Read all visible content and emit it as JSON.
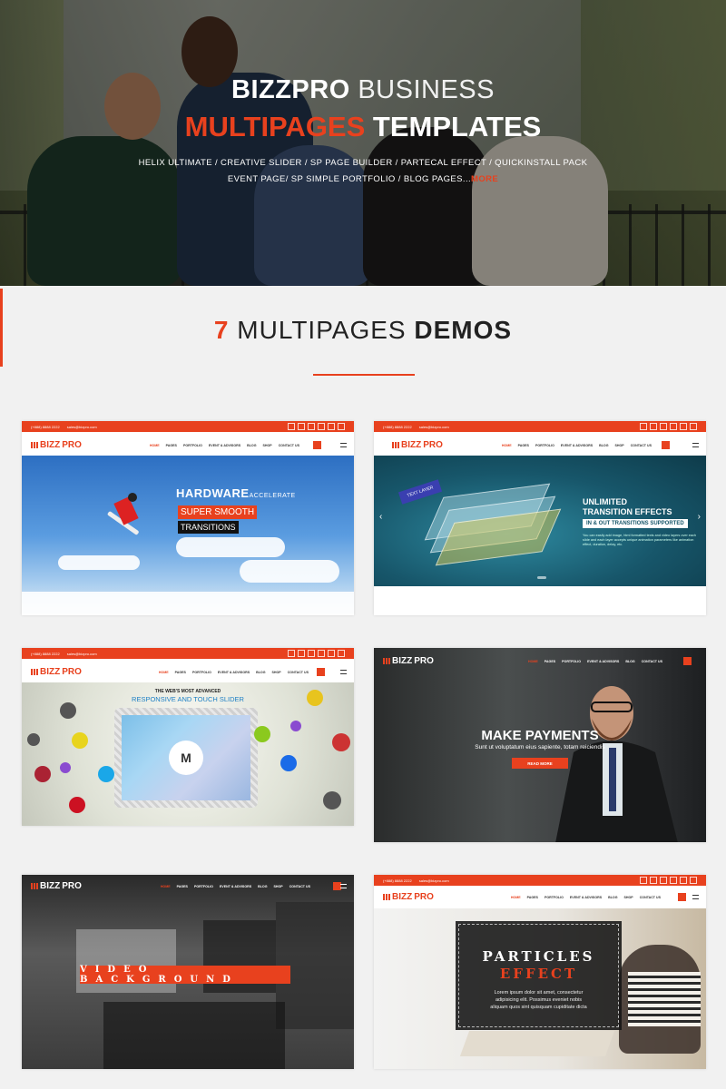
{
  "hero": {
    "title_brand": "BIZZPRO",
    "title_rest": " BUSINESS",
    "title2_accent": "MULTIPAGES",
    "title2_rest": " TEMPLATES",
    "sub1": "HELIX ULTIMATE / CREATIVE SLIDER / SP PAGE BUILDER / PARTECAL EFFECT / QUICKINSTALL PACK",
    "sub2": "EVENT PAGE/ SP SIMPLE PORTFOLIO / BLOG PAGES...",
    "more": "MORE"
  },
  "section": {
    "num": "7",
    "mid": " MULTIPAGES ",
    "bold": "DEMOS"
  },
  "demo": {
    "phone": "(+888) 8888 2222",
    "email": "sales@bizpro.com",
    "logo_a": "BIZZ",
    "logo_b": "PRO",
    "menu": [
      "HOME",
      "PAGES",
      "PORTFOLIO",
      "EVENT & ADVISORS",
      "BLOG",
      "SHOP",
      "CONTACT US"
    ]
  },
  "card1": {
    "title": "HARDWARE",
    "thin": "ACCELERATE",
    "red": "SUPER SMOOTH",
    "black": "TRANSITIONS"
  },
  "card2": {
    "textlayer": "TEXT LAYER",
    "l1": "UNLIMITED",
    "l2": "TRANSITION EFFECTS",
    "bar": "IN & OUT TRANSITIONS SUPPORTED",
    "para": "You can easily add image, html formatted texts and video layers over each slide and each layer accepts unique animation parameters like animation effect, duration, delay, etc."
  },
  "card3": {
    "k1": "THE WEB'S MOST ADVANCED",
    "k2": "RESPONSIVE AND TOUCH SLIDER",
    "mark": "M"
  },
  "card4": {
    "title": "MAKE PAYMENTS",
    "sub": "Sunt ut voluptatum eius sapiente, totam reiciendis",
    "btn": "READ MORE"
  },
  "card5": {
    "bar": "VIDEO BACKGROUND"
  },
  "card6": {
    "l1": "PARTICLES",
    "l2": "EFFECT",
    "p1": "Lorem ipsum dolor sit amet, consectetur",
    "p2": "adipisicing elit. Possimus eveniet nobis",
    "p3": "aliquam quos sint quisquam cupiditate dicta"
  },
  "colors": {
    "accent": "#e8411e",
    "dark": "#222222",
    "background": "#f1f1f1"
  }
}
